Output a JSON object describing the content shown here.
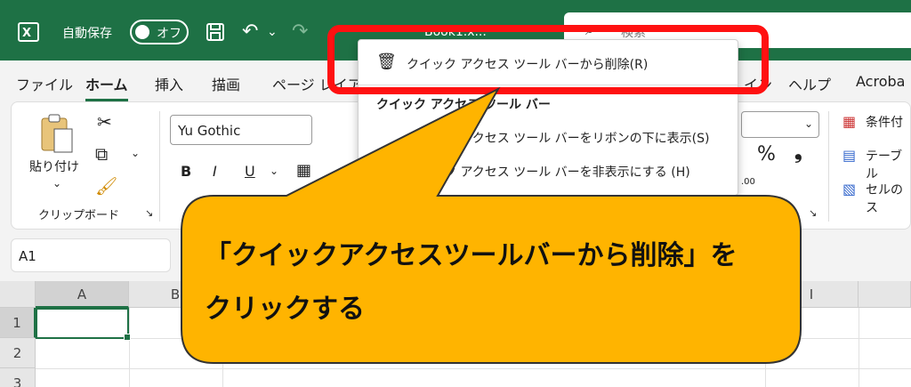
{
  "titlebar": {
    "autosave_label": "自動保存",
    "toggle_label": "オフ",
    "book_name": "Book1.x...",
    "search_placeholder": "検索"
  },
  "tabs": [
    "ファイル",
    "ホーム",
    "挿入",
    "描画",
    "ページ レイア",
    "イン",
    "ヘルプ",
    "Acroba"
  ],
  "ribbon": {
    "paste_label": "貼り付け",
    "clipboard_label": "クリップボード",
    "font_name": "Yu Gothic",
    "bold": "B",
    "italic": "I",
    "underline": "U",
    "percent": "%",
    "comma": "❟",
    "styles": [
      "条件付",
      "テーブル",
      "セルのス"
    ]
  },
  "namebox": "A1",
  "grid": {
    "columns": [
      "A",
      "B",
      "I"
    ],
    "rows": [
      "1",
      "2",
      "3"
    ]
  },
  "menu": {
    "items": [
      "クイック アクセス ツール バーから削除(R)",
      "クイック アクセス ツール バー",
      "クイック アクセス ツール バーをリボンの下に表示(S)",
      "クイック アクセス ツール バーを非表示にする (H)"
    ]
  },
  "callout": {
    "line1": "「クイックアクセスツールバーから削除」を",
    "line2": "クリックする"
  },
  "colors": {
    "excel_green": "#1e7145",
    "highlight_red": "#ff1111",
    "callout_yellow": "#ffb400"
  }
}
